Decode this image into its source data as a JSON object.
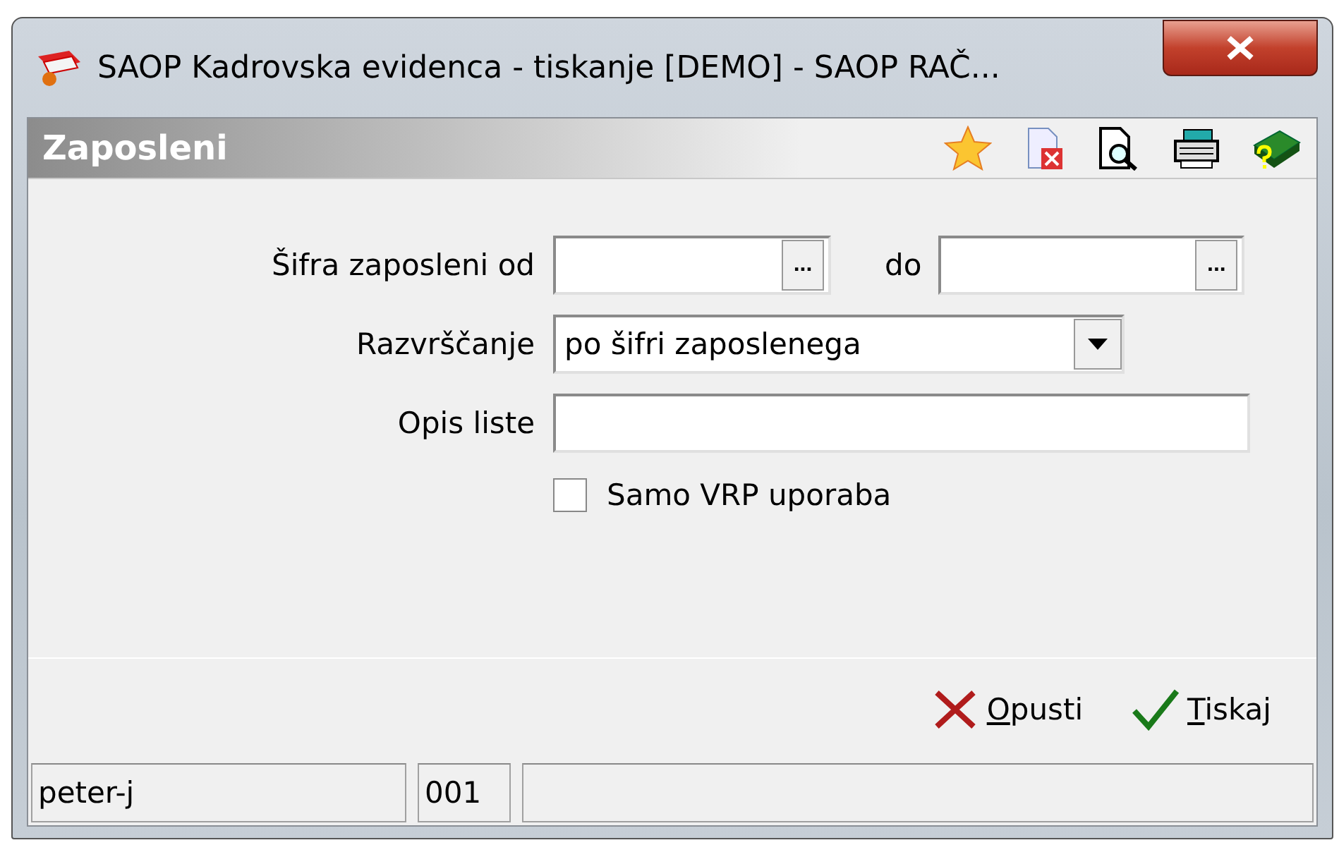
{
  "window": {
    "title": "SAOP Kadrovska evidenca - tiskanje [DEMO] - SAOP RAČ..."
  },
  "header": {
    "title": "Zaposleni"
  },
  "form": {
    "from_label": "Šifra zaposleni od",
    "from_button": "...",
    "to_label": "do",
    "to_button": "...",
    "sort_label": "Razvrščanje",
    "sort_value": "po šifri zaposlenega",
    "desc_label": "Opis liste",
    "checkbox": {
      "label": "Samo VRP uporaba",
      "checked": false
    }
  },
  "buttons": [
    {
      "kind": "cancel",
      "label": "Opusti"
    },
    {
      "kind": "print",
      "label": "Tiskaj"
    }
  ],
  "status_bar": [
    "peter-j",
    "001"
  ]
}
